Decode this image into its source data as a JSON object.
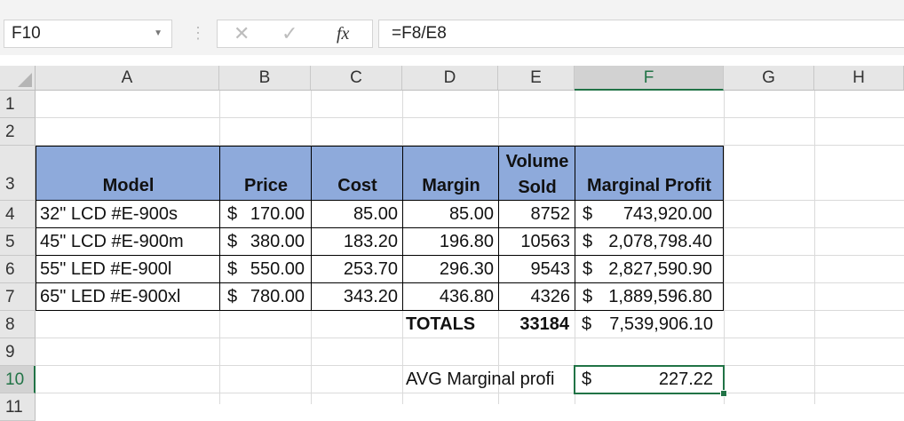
{
  "name_box": "F10",
  "formula": "=F8/E8",
  "fx_label": "fx",
  "columns": [
    "A",
    "B",
    "C",
    "D",
    "E",
    "F",
    "G",
    "H"
  ],
  "rows": [
    "1",
    "2",
    "3",
    "4",
    "5",
    "6",
    "7",
    "8",
    "9",
    "10",
    "11"
  ],
  "selected_cell": "F10",
  "header": {
    "model": "Model",
    "price": "Price",
    "cost": "Cost",
    "margin": "Margin",
    "volume_line1": "Volume",
    "volume_line2": "Sold",
    "marginal_profit": "Marginal Profit",
    "fill_color": "#8eaadb"
  },
  "data_rows": [
    {
      "model": "32\" LCD #E-900s",
      "price": "170.00",
      "cost": "85.00",
      "margin": "85.00",
      "volume": "8752",
      "profit": "743,920.00"
    },
    {
      "model": "45\" LCD #E-900m",
      "price": "380.00",
      "cost": "183.20",
      "margin": "196.80",
      "volume": "10563",
      "profit": "2,078,798.40"
    },
    {
      "model": "55\" LED #E-900l",
      "price": "550.00",
      "cost": "253.70",
      "margin": "296.30",
      "volume": "9543",
      "profit": "2,827,590.90"
    },
    {
      "model": "65\" LED #E-900xl",
      "price": "780.00",
      "cost": "343.20",
      "margin": "436.80",
      "volume": "4326",
      "profit": "1,889,596.80"
    }
  ],
  "currency_symbol": "$",
  "totals": {
    "label": "TOTALS",
    "volume": "33184",
    "profit": "7,539,906.10"
  },
  "avg": {
    "label": "AVG Marginal profi",
    "value": "227.22"
  }
}
